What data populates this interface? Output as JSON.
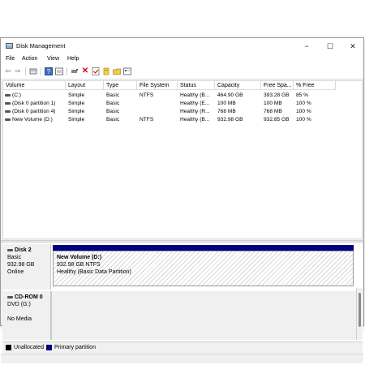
{
  "window": {
    "title": "Disk Management",
    "controls": [
      "−",
      "☐",
      "✕"
    ]
  },
  "menu": [
    "File",
    "Action",
    "View",
    "Help"
  ],
  "toolbar": {
    "buttons": [
      "back-arrow-icon",
      "forward-arrow-icon",
      "properties-icon",
      "help-icon",
      "list-view-icon",
      "connect-icon",
      "delete-icon",
      "check-icon",
      "rescan-icon",
      "folder-icon",
      "details-icon"
    ]
  },
  "volume_list": {
    "columns": [
      "Volume",
      "Layout",
      "Type",
      "File System",
      "Status",
      "Capacity",
      "Free Spa...",
      "% Free"
    ],
    "rows": [
      [
        "(C:)",
        "Simple",
        "Basic",
        "NTFS",
        "Healthy (B...",
        "464.90 GB",
        "393.28 GB",
        "85 %"
      ],
      [
        "(Disk 0 partition 1)",
        "Simple",
        "Basic",
        "",
        "Healthy (E...",
        "100 MB",
        "100 MB",
        "100 %"
      ],
      [
        "(Disk 0 partition 4)",
        "Simple",
        "Basic",
        "",
        "Healthy (R...",
        "768 MB",
        "768 MB",
        "100 %"
      ],
      [
        "New Volume (D:)",
        "Simple",
        "Basic",
        "NTFS",
        "Healthy (B...",
        "932.98 GB",
        "932.85 GB",
        "100 %"
      ]
    ]
  },
  "disks": [
    {
      "name": "Disk 2",
      "type": "Basic",
      "size": "932.98 GB",
      "status": "Online",
      "partition": {
        "name": "New Volume  (D:)",
        "size_fs": "932.98 GB NTFS",
        "status": "Healthy (Basic Data Partition)"
      }
    },
    {
      "name": "CD-ROM 0",
      "type": "DVD (G:)",
      "status": "No Media"
    }
  ],
  "legend": [
    {
      "label": "Unallocated",
      "color": "#000000"
    },
    {
      "label": "Primary partition",
      "color": "#00007f"
    }
  ]
}
